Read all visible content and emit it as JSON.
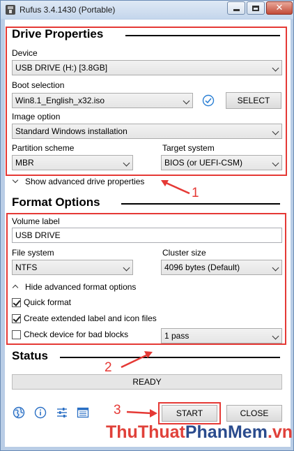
{
  "window": {
    "title": "Rufus 3.4.1430 (Portable)",
    "close_glyph": "✕"
  },
  "drive_properties": {
    "heading": "Drive Properties",
    "device_label": "Device",
    "device_value": "USB DRIVE (H:) [3.8GB]",
    "boot_selection_label": "Boot selection",
    "boot_selection_value": "Win8.1_English_x32.iso",
    "select_button": "SELECT",
    "image_option_label": "Image option",
    "image_option_value": "Standard Windows installation",
    "partition_scheme_label": "Partition scheme",
    "partition_scheme_value": "MBR",
    "target_system_label": "Target system",
    "target_system_value": "BIOS (or UEFI-CSM)",
    "advanced_toggle": "Show advanced drive properties"
  },
  "format_options": {
    "heading": "Format Options",
    "volume_label_label": "Volume label",
    "volume_label_value": "USB DRIVE",
    "file_system_label": "File system",
    "file_system_value": "NTFS",
    "cluster_size_label": "Cluster size",
    "cluster_size_value": "4096 bytes (Default)",
    "advanced_toggle": "Hide advanced format options",
    "quick_format_label": "Quick format",
    "quick_format_checked": true,
    "extended_label_label": "Create extended label and icon files",
    "extended_label_checked": true,
    "bad_blocks_label": "Check device for bad blocks",
    "bad_blocks_checked": false,
    "passes_value": "1 pass"
  },
  "status": {
    "heading": "Status",
    "value": "READY"
  },
  "footer": {
    "start_button": "START",
    "close_button": "CLOSE",
    "icons": [
      "globe-icon",
      "info-icon",
      "settings-sliders-icon",
      "log-icon"
    ]
  },
  "annotations": {
    "one": "1",
    "two": "2",
    "three": "3",
    "color": "#e53935"
  },
  "watermark": {
    "part1": "ThuThuat",
    "part2": "PhanMem",
    "part3": ".vn",
    "color1": "#e0413a",
    "color2": "#e0413a"
  }
}
